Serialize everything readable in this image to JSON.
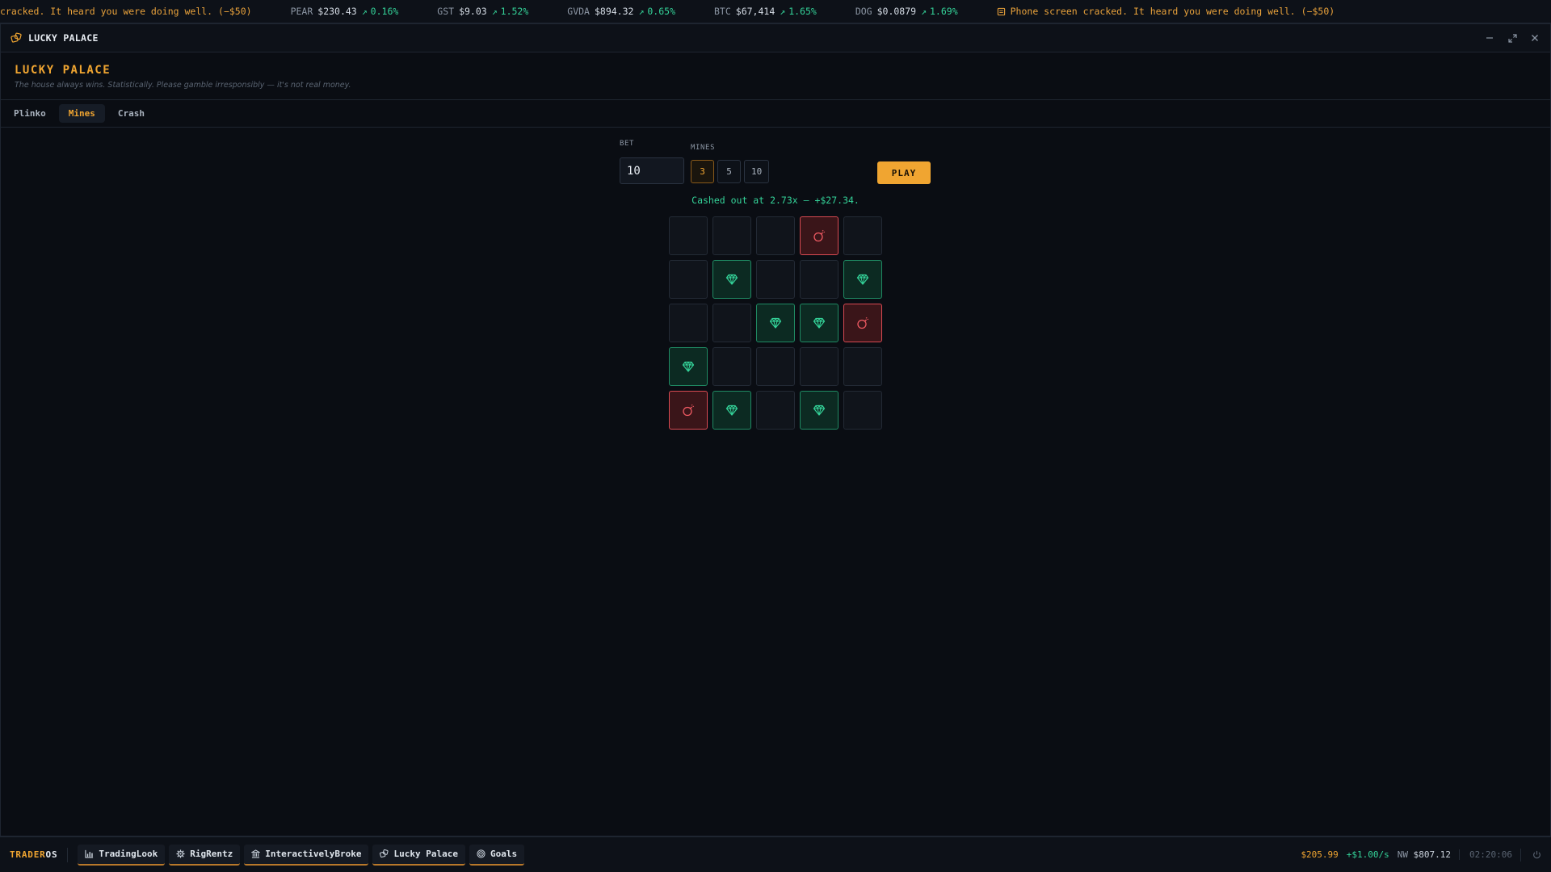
{
  "ticker": {
    "news_tail": "cracked. It heard you were doing well. (−$50)",
    "items": [
      {
        "symbol": "PEAR",
        "price": "$230.43",
        "change": "0.16%"
      },
      {
        "symbol": "GST",
        "price": "$9.03",
        "change": "1.52%"
      },
      {
        "symbol": "GVDA",
        "price": "$894.32",
        "change": "0.65%"
      },
      {
        "symbol": "BTC",
        "price": "$67,414",
        "change": "1.65%"
      },
      {
        "symbol": "DOG",
        "price": "$0.0879",
        "change": "1.69%"
      }
    ],
    "news_full": "Phone screen cracked. It heard you were doing well. (−$50)",
    "colors": {
      "news": "#e9a23b",
      "up": "#34d399"
    }
  },
  "window": {
    "title": "LUCKY PALACE",
    "controls": [
      "minimize-icon",
      "restore-icon",
      "close-icon"
    ]
  },
  "header": {
    "brand": "LUCKY PALACE",
    "tagline": "The house always wins. Statistically. Please gamble irresponsibly — it's not real money."
  },
  "tabs": [
    {
      "label": "Plinko",
      "active": false
    },
    {
      "label": "Mines",
      "active": true
    },
    {
      "label": "Crash",
      "active": false
    }
  ],
  "game": {
    "bet_label": "BET",
    "bet_value": "10",
    "mines_label": "MINES",
    "mine_options": [
      {
        "label": "3",
        "active": true
      },
      {
        "label": "5",
        "active": false
      },
      {
        "label": "10",
        "active": false
      }
    ],
    "play_label": "PLAY",
    "status": "Cashed out at 2.73x — +$27.34.",
    "grid": [
      [
        "empty",
        "empty",
        "empty",
        "mine",
        "empty"
      ],
      [
        "empty",
        "gem",
        "empty",
        "empty",
        "gem"
      ],
      [
        "empty",
        "empty",
        "gem",
        "gem",
        "mine"
      ],
      [
        "gem",
        "empty",
        "empty",
        "empty",
        "empty"
      ],
      [
        "mine",
        "gem",
        "empty",
        "gem",
        "empty"
      ]
    ],
    "colors": {
      "gem": "#34d399",
      "mine": "#ef5a62",
      "accent": "#f0a531"
    }
  },
  "taskbar": {
    "logo_a": "TRADER",
    "logo_b": "OS",
    "apps": [
      {
        "label": "TradingLook",
        "icon": "chart-icon"
      },
      {
        "label": "RigRentz",
        "icon": "gear-icon"
      },
      {
        "label": "InteractivelyBroke",
        "icon": "bank-icon"
      },
      {
        "label": "Lucky Palace",
        "icon": "dice-icon"
      },
      {
        "label": "Goals",
        "icon": "target-icon"
      }
    ],
    "cash": "$205.99",
    "rate": "+$1.00/s",
    "nw_label": "NW",
    "nw_value": "$807.12",
    "clock": "02:20:06"
  }
}
